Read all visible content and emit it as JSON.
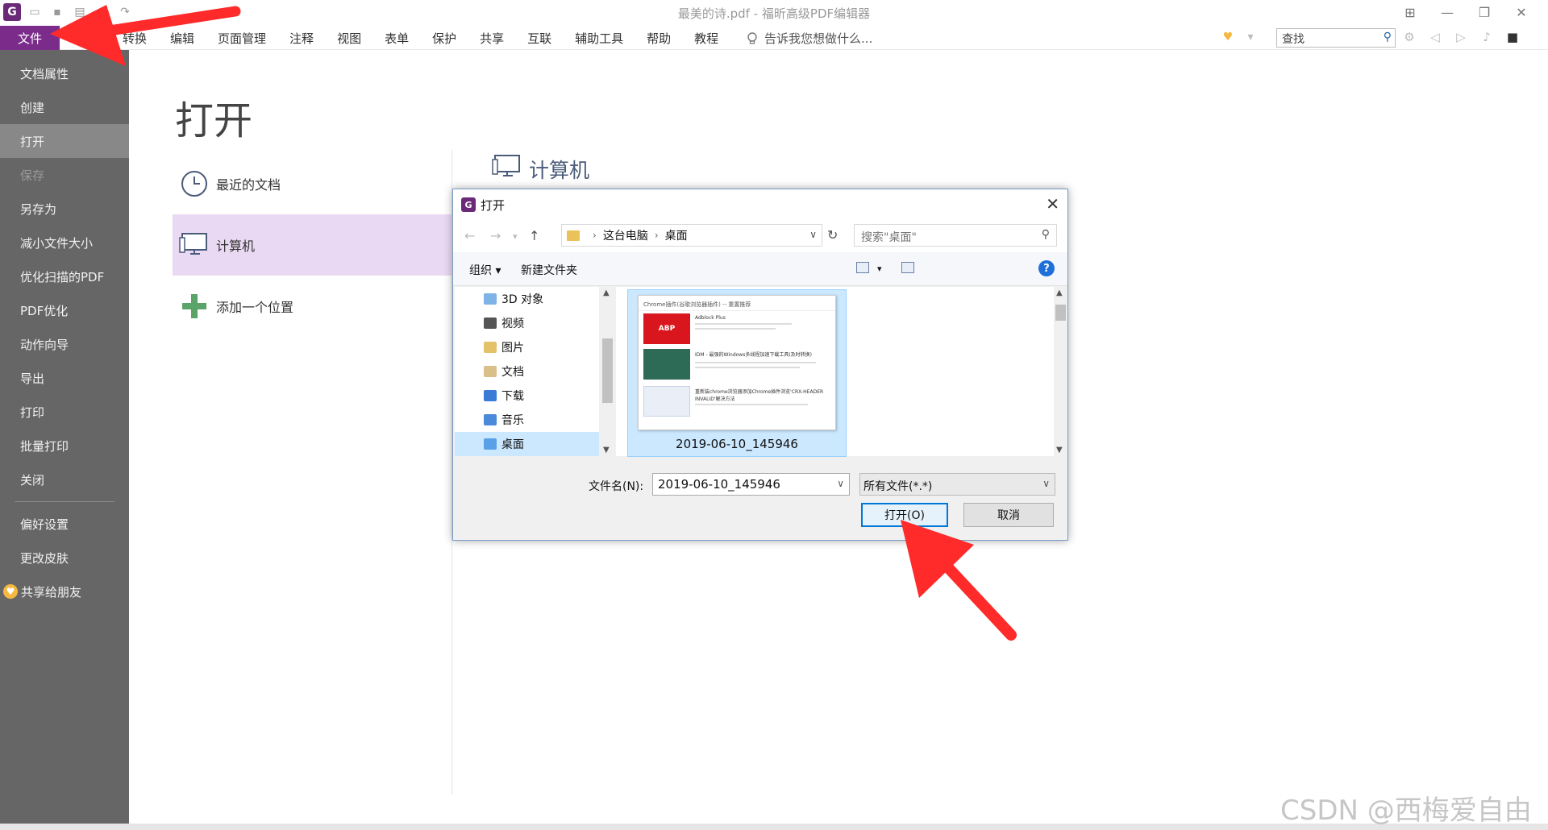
{
  "window": {
    "title": "最美的诗.pdf - 福昕高级PDF编辑器"
  },
  "menubar": {
    "file": "文件",
    "items": [
      "转换",
      "编辑",
      "页面管理",
      "注释",
      "视图",
      "表单",
      "保护",
      "共享",
      "互联",
      "辅助工具",
      "帮助",
      "教程"
    ],
    "tell_me": "告诉我您想做什么...",
    "find_placeholder": "查找"
  },
  "sidebar": {
    "items": [
      "文档属性",
      "创建",
      "打开",
      "保存",
      "另存为",
      "减小文件大小",
      "优化扫描的PDF",
      "PDF优化",
      "动作向导",
      "导出",
      "打印",
      "批量打印",
      "关闭"
    ],
    "items2": [
      "偏好设置",
      "更改皮肤",
      "共享给朋友"
    ]
  },
  "backstage": {
    "heading": "打开",
    "places": [
      "最近的文档",
      "计算机",
      "添加一个位置"
    ],
    "computer_heading": "计算机"
  },
  "dialog": {
    "title": "打开",
    "breadcrumb": [
      "这台电脑",
      "桌面"
    ],
    "search_placeholder": "搜索\"桌面\"",
    "organize": "组织",
    "new_folder": "新建文件夹",
    "help": "?",
    "tree": [
      "3D 对象",
      "视频",
      "图片",
      "文档",
      "下载",
      "音乐",
      "桌面"
    ],
    "file_caption": "2019-06-10_145946",
    "filename_label": "文件名(N):",
    "filename_value": "2019-06-10_145946",
    "filetype": "所有文件(*.*)",
    "open_button": "打开(O)",
    "cancel_button": "取消"
  },
  "thumbnail": {
    "header": "Chrome插件(谷歌浏览器插件) -- 重置推荐",
    "items": [
      "Adblock Plus",
      "IDM - 最强的Windows多线程加速下载工具(及时转换)",
      "重新装chrome浏览器添加Chrome插件浏览'CRX-HEADER INVALID'解决方法"
    ],
    "logo1": "ABP"
  },
  "watermark": "CSDN @西梅爱自由",
  "colors": {
    "accent": "#7b2c8b",
    "sidebar": "#666666",
    "selection": "#ead9f2",
    "dialog_blue": "#0078d7",
    "arrow": "#ff2a2a"
  }
}
